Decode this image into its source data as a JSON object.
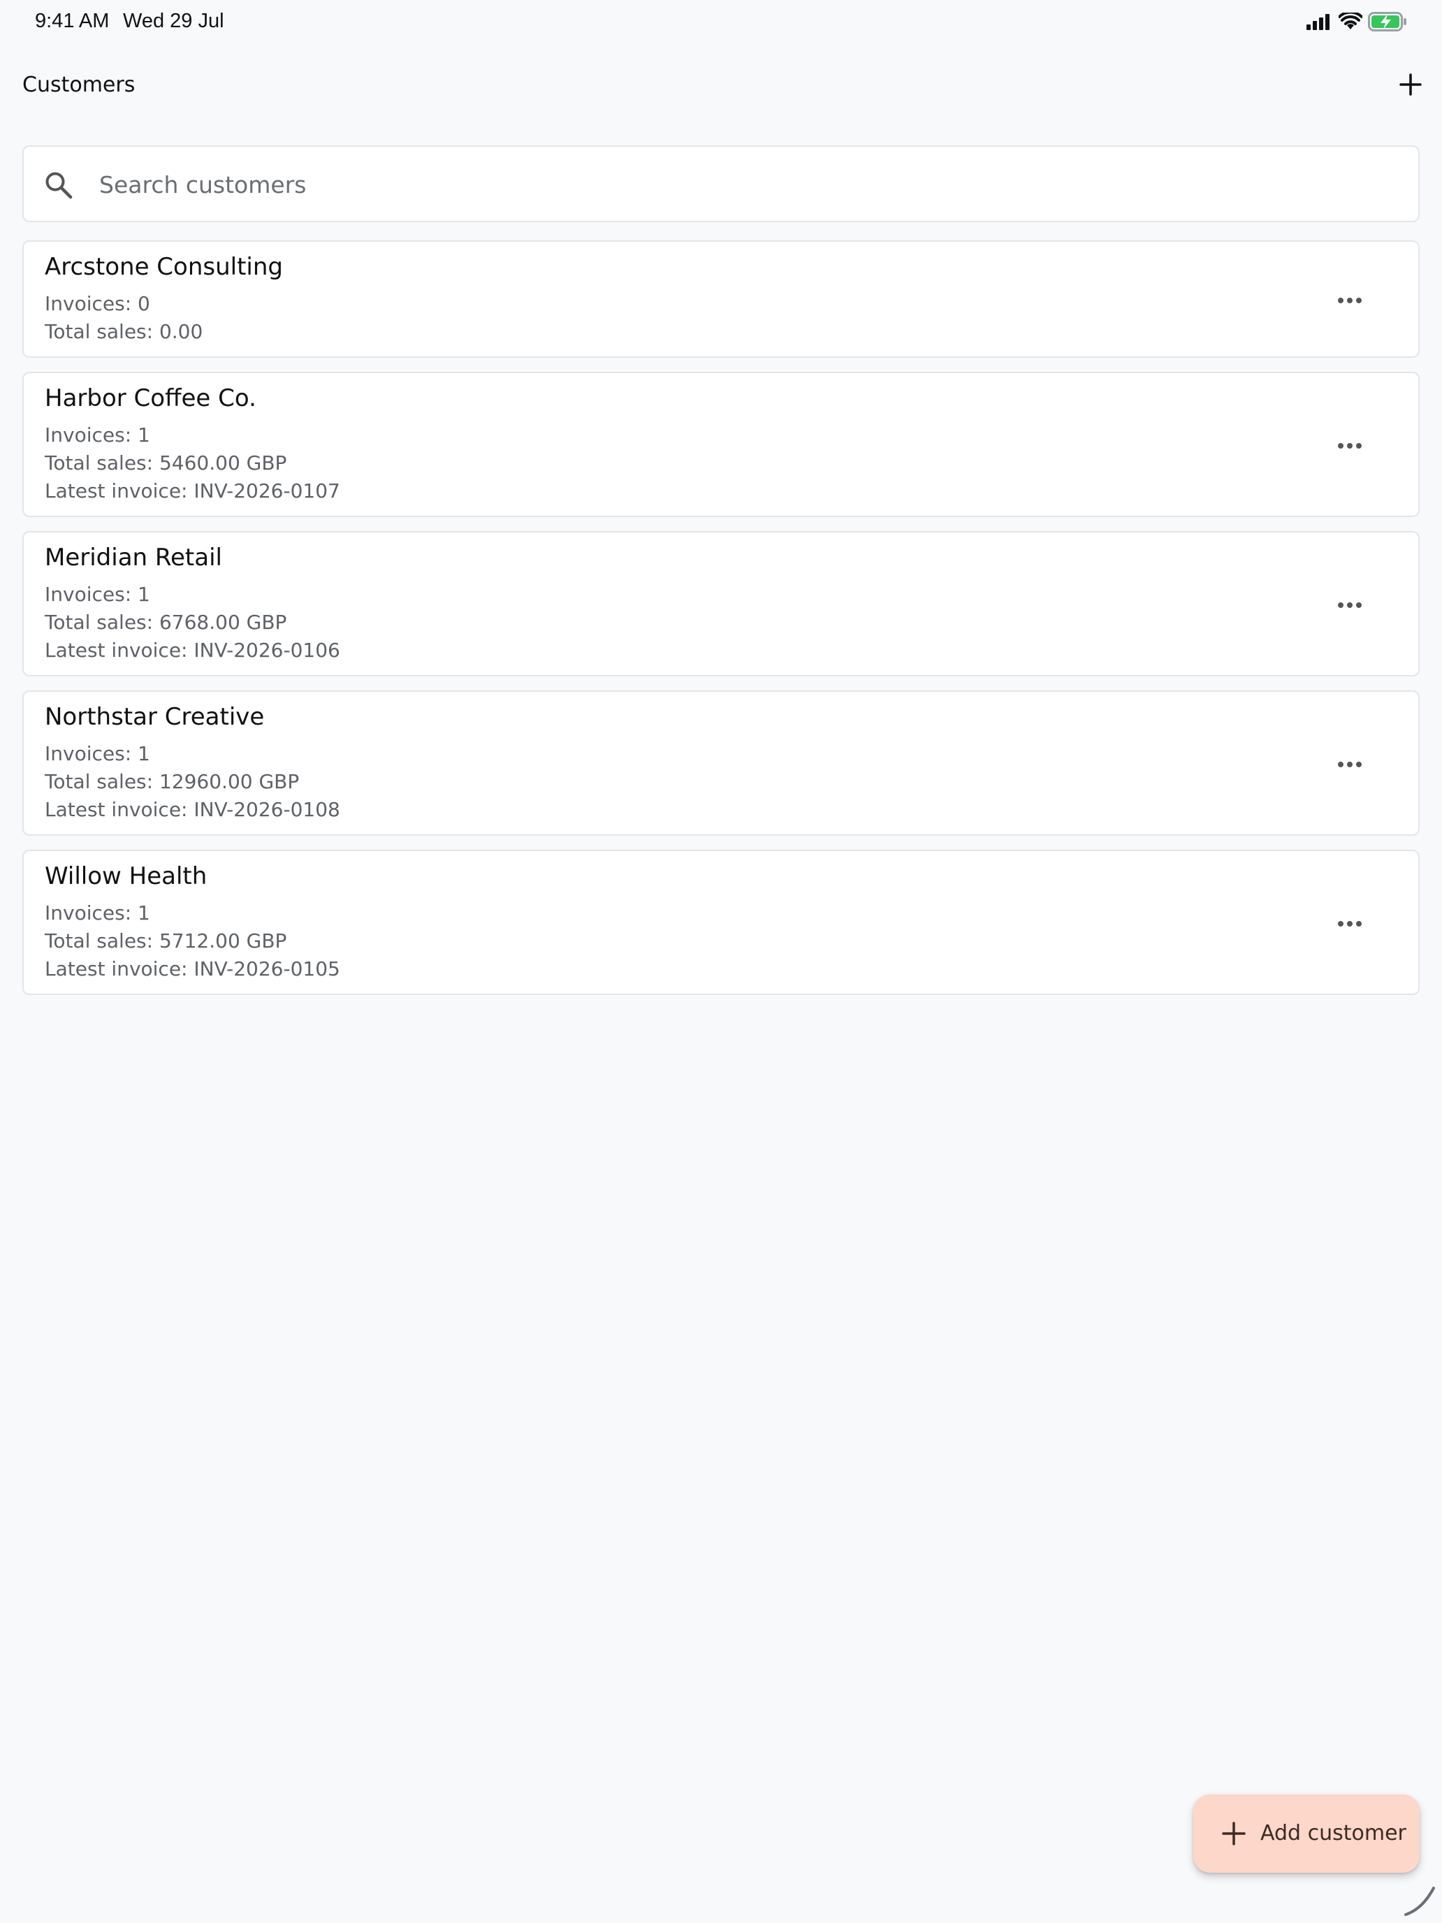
{
  "status_bar": {
    "time": "9:41 AM",
    "date": "Wed 29 Jul",
    "icons": [
      "cellular-signal-icon",
      "wifi-icon",
      "battery-charging-icon"
    ],
    "battery_color": "#34c759"
  },
  "header": {
    "title": "Customers",
    "add_icon": "plus-icon"
  },
  "search": {
    "placeholder": "Search customers",
    "value": "",
    "icon": "search-icon"
  },
  "customers": [
    {
      "name": "Arcstone Consulting",
      "invoices": "Invoices: 0",
      "total_sales": "Total sales: 0.00"
    },
    {
      "name": "Harbor Coffee Co.",
      "invoices": "Invoices: 1",
      "total_sales": "Total sales: 5460.00 GBP",
      "latest_invoice": "Latest invoice: INV-2026-0107"
    },
    {
      "name": "Meridian Retail",
      "invoices": "Invoices: 1",
      "total_sales": "Total sales: 6768.00 GBP",
      "latest_invoice": "Latest invoice: INV-2026-0106"
    },
    {
      "name": "Northstar Creative",
      "invoices": "Invoices: 1",
      "total_sales": "Total sales: 12960.00 GBP",
      "latest_invoice": "Latest invoice: INV-2026-0108"
    },
    {
      "name": "Willow Health",
      "invoices": "Invoices: 1",
      "total_sales": "Total sales: 5712.00 GBP",
      "latest_invoice": "Latest invoice: INV-2026-0105"
    }
  ],
  "fab": {
    "label": "Add customer",
    "icon": "plus-icon",
    "background": "#fdd7c9"
  }
}
